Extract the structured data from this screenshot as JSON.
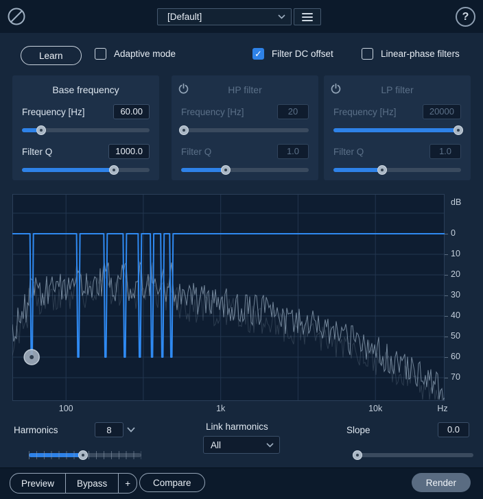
{
  "topbar": {
    "preset": "[Default]"
  },
  "icons": {
    "help_glyph": "?",
    "check_glyph": "✓"
  },
  "controls": {
    "learn_label": "Learn",
    "checkboxes": [
      {
        "label": "Adaptive mode",
        "checked": false
      },
      {
        "label": "Filter DC offset",
        "checked": true
      },
      {
        "label": "Linear-phase filters",
        "checked": false
      }
    ]
  },
  "panels": {
    "base": {
      "title": "Base frequency",
      "freq_label": "Frequency [Hz]",
      "freq_value": "60.00",
      "q_label": "Filter Q",
      "q_value": "1000.0"
    },
    "hp": {
      "title": "HP filter",
      "freq_label": "Frequency [Hz]",
      "freq_value": "20",
      "q_label": "Filter Q",
      "q_value": "1.0"
    },
    "lp": {
      "title": "LP filter",
      "freq_label": "Frequency [Hz]",
      "freq_value": "20000",
      "q_label": "Filter Q",
      "q_value": "1.0"
    }
  },
  "spectrum": {
    "db_axis_title": "dB",
    "db_ticks": [
      "0",
      "10",
      "20",
      "30",
      "40",
      "50",
      "60",
      "70"
    ],
    "freq_ticks": [
      {
        "label": "100",
        "f": 100
      },
      {
        "label": "1k",
        "f": 1000
      },
      {
        "label": "10k",
        "f": 10000
      }
    ],
    "hz_label": "Hz",
    "base_frequency_hz": 60,
    "harmonics": 8,
    "notch_depth_db": 60,
    "accent_color": "#2e82e8",
    "curve_color": "#2f8af2",
    "trace_color": "#8093a7"
  },
  "bottom": {
    "harmonics_label": "Harmonics",
    "harmonics_value": "8",
    "link_label": "Link harmonics",
    "link_value": "All",
    "slope_label": "Slope",
    "slope_value": "0.0"
  },
  "footer": {
    "preview": "Preview",
    "bypass": "Bypass",
    "add": "+",
    "compare": "Compare",
    "render": "Render"
  }
}
